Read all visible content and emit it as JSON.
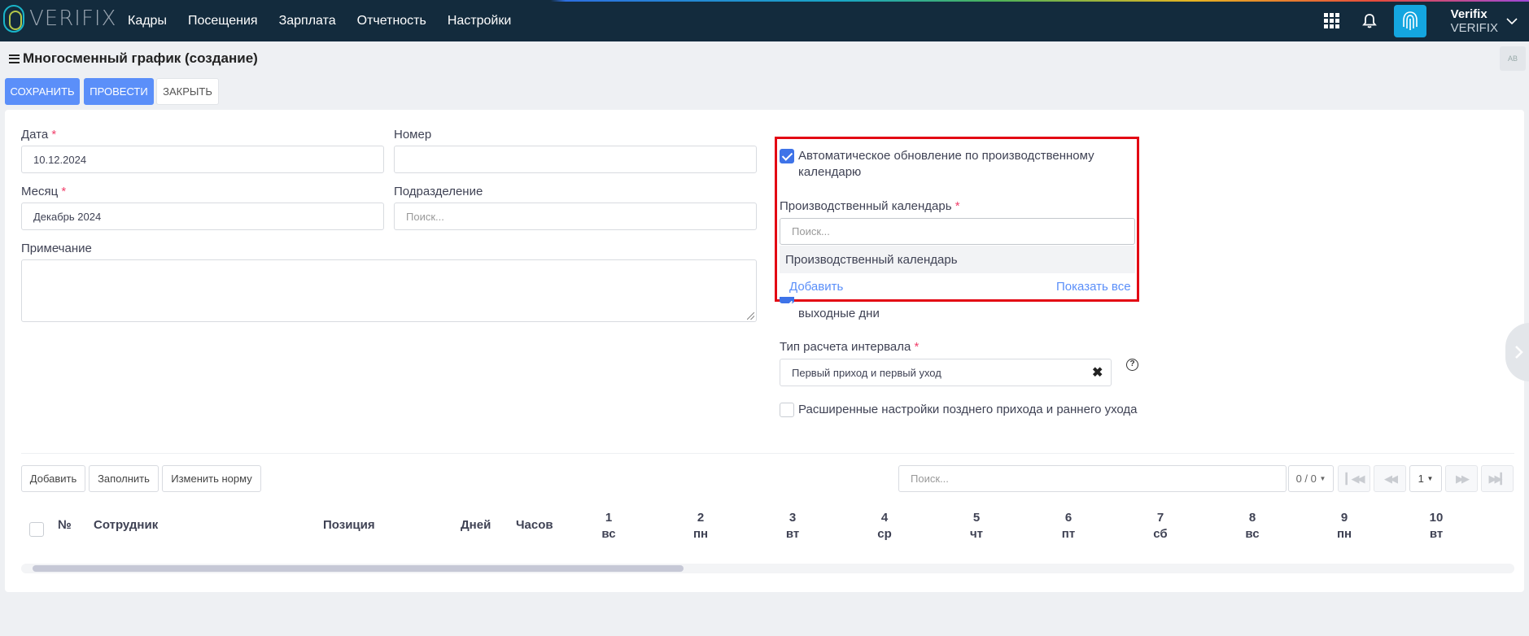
{
  "app": {
    "logo_text": "VERIFIX",
    "nav": [
      "Кадры",
      "Посещения",
      "Зарплата",
      "Отчетность",
      "Настройки"
    ],
    "user_name": "Verifix",
    "user_org": "VERIFIX"
  },
  "page": {
    "title": "Многосменный график (создание)",
    "buttons": {
      "save": "СОХРАНИТЬ",
      "post": "ПРОВЕСТИ",
      "close": "ЗАКРЫТЬ"
    },
    "toggle_label": "AB"
  },
  "form": {
    "date_label": "Дата",
    "date_value": "10.12.2024",
    "number_label": "Номер",
    "number_value": "",
    "month_label": "Месяц",
    "month_value": "Декабрь 2024",
    "division_label": "Подразделение",
    "division_placeholder": "Поиск...",
    "note_label": "Примечание",
    "required_mark": "*",
    "auto_update_label": "Автоматическое обновление по производственному календарю",
    "auto_update_checked": true,
    "prod_calendar_label": "Производственный календарь",
    "prod_calendar_placeholder": "Поиск...",
    "prod_calendar_option": "Производственный календарь",
    "add_link": "Добавить",
    "show_all_link": "Показать все",
    "weekends_label": "выходные дни",
    "interval_label": "Тип расчета интервала",
    "interval_value": "Первый приход и первый уход",
    "clear_symbol": "✖",
    "help_symbol": "?",
    "advanced_label": "Расширенные настройки позднего прихода и раннего ухода",
    "advanced_checked": false
  },
  "table_toolbar": {
    "add": "Добавить",
    "fill": "Заполнить",
    "change_norm": "Изменить норму",
    "search_placeholder": "Поиск...",
    "count": "0 / 0",
    "page": "1"
  },
  "table": {
    "columns": {
      "num": "№",
      "employee": "Сотрудник",
      "position": "Позиция",
      "days": "Дней",
      "hours": "Часов"
    },
    "days": [
      {
        "n": "1",
        "d": "вс"
      },
      {
        "n": "2",
        "d": "пн"
      },
      {
        "n": "3",
        "d": "вт"
      },
      {
        "n": "4",
        "d": "ср"
      },
      {
        "n": "5",
        "d": "чт"
      },
      {
        "n": "6",
        "d": "пт"
      },
      {
        "n": "7",
        "d": "сб"
      },
      {
        "n": "8",
        "d": "вс"
      },
      {
        "n": "9",
        "d": "пн"
      },
      {
        "n": "10",
        "d": "вт"
      }
    ]
  },
  "colors": {
    "topbar": "#132b3d",
    "primary": "#5b8ff9",
    "highlight": "#e30613",
    "checkbox": "#3e73e8"
  }
}
